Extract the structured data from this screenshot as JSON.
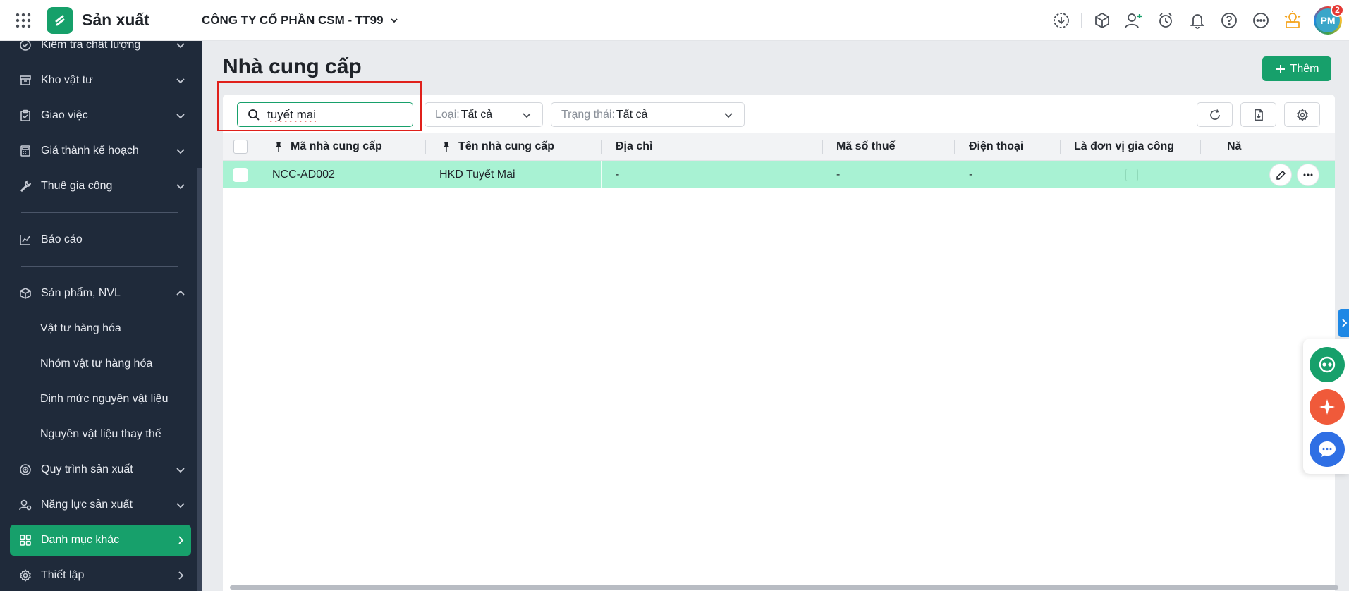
{
  "app": {
    "title": "Sản xuất",
    "company": "CÔNG TY CỔ PHẦN CSM - TT99"
  },
  "user": {
    "initials": "PM",
    "notifications": "2"
  },
  "sidebar": {
    "items": [
      {
        "label": "Kiểm tra chất lượng",
        "icon": "check-circle-icon"
      },
      {
        "label": "Kho vật tư",
        "icon": "archive-box-icon"
      },
      {
        "label": "Giao việc",
        "icon": "clipboard-icon"
      },
      {
        "label": "Giá thành kế hoạch",
        "icon": "calculator-icon"
      },
      {
        "label": "Thuê gia công",
        "icon": "wrench-icon"
      },
      {
        "label": "Báo cáo",
        "icon": "chart-icon"
      },
      {
        "label": "Sản phẩm, NVL",
        "icon": "box-icon"
      },
      {
        "label": "Quy trình sản xuất",
        "icon": "process-icon"
      },
      {
        "label": "Năng lực sản xuất",
        "icon": "capacity-icon"
      },
      {
        "label": "Danh mục khác",
        "icon": "grid-icon"
      },
      {
        "label": "Thiết lập",
        "icon": "gear-icon"
      }
    ],
    "subitems": [
      {
        "label": "Vật tư hàng hóa"
      },
      {
        "label": "Nhóm vật tư hàng hóa"
      },
      {
        "label": "Định mức nguyên vật liệu"
      },
      {
        "label": "Nguyên vật liệu thay thế"
      }
    ]
  },
  "page": {
    "title": "Nhà cung cấp",
    "add_label": "Thêm"
  },
  "search": {
    "value": "tuyết mai"
  },
  "filters": {
    "type": {
      "label": "Loại:",
      "value": "Tất cả"
    },
    "status": {
      "label": "Trạng thái:",
      "value": "Tất cả"
    }
  },
  "table": {
    "columns": [
      "Mã nhà cung cấp",
      "Tên nhà cung cấp",
      "Địa chỉ",
      "Mã số thuế",
      "Điện thoại",
      "Là đơn vị gia công",
      "Nă"
    ],
    "rows": [
      {
        "code": "NCC-AD002",
        "name": "HKD Tuyết Mai",
        "address": "-",
        "tax": "-",
        "phone": "-"
      }
    ]
  },
  "colors": {
    "accent": "#17a06b",
    "sidebar_bg": "#1f2a3a",
    "row_selected": "#a8f2d3",
    "highlight": "#e0201b"
  }
}
